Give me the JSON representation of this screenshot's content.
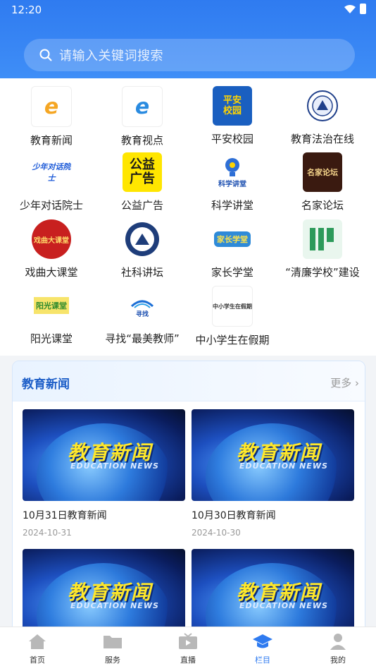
{
  "status": {
    "time": "12:20"
  },
  "search": {
    "placeholder": "请输入关键词搜索"
  },
  "categories": [
    {
      "label": "教育新闻",
      "icon": "education-news-logo",
      "text": "教育新闻"
    },
    {
      "label": "教育视点",
      "icon": "education-viewpoint-logo",
      "text": "教育视点"
    },
    {
      "label": "平安校园",
      "icon": "safe-campus-logo",
      "text": "平安校园"
    },
    {
      "label": "教育法治在线",
      "icon": "education-law-emblem",
      "text": ""
    },
    {
      "label": "少年对话院士",
      "icon": "youth-dialogue-logo",
      "text": "少年对话院士"
    },
    {
      "label": "公益广告",
      "icon": "public-ad-logo",
      "text": "公益广告"
    },
    {
      "label": "科学讲堂",
      "icon": "science-lecture-bulb",
      "text": "科学讲堂"
    },
    {
      "label": "名家论坛",
      "icon": "master-forum-logo",
      "text": "名家论坛"
    },
    {
      "label": "戏曲大课堂",
      "icon": "opera-class-logo",
      "text": "戏曲大课堂"
    },
    {
      "label": "社科讲坛",
      "icon": "social-science-emblem",
      "text": ""
    },
    {
      "label": "家长学堂",
      "icon": "parent-school-logo",
      "text": "家长学堂"
    },
    {
      "label": "“清廉学校”建设",
      "icon": "clean-school-logo",
      "text": ""
    },
    {
      "label": "阳光课堂",
      "icon": "sunshine-class-logo",
      "text": "阳光课堂"
    },
    {
      "label": "寻找“最美教师”",
      "icon": "best-teacher-logo",
      "text": "寻找 “最美教师”"
    },
    {
      "label": "中小学生在假期",
      "icon": "students-holiday-logo",
      "text": "中小学生在假期"
    }
  ],
  "news": {
    "title": "教育新闻",
    "more": "更多",
    "thumb_title": "教育新闻",
    "thumb_sub": "EDUCATION NEWS",
    "items": [
      {
        "title": "10月31日教育新闻",
        "date": "2024-10-31"
      },
      {
        "title": "10月30日教育新闻",
        "date": "2024-10-30"
      },
      {
        "title": "",
        "date": ""
      },
      {
        "title": "",
        "date": ""
      }
    ]
  },
  "tabs": [
    {
      "label": "首页",
      "icon": "home-icon"
    },
    {
      "label": "服务",
      "icon": "folder-icon"
    },
    {
      "label": "直播",
      "icon": "tv-icon"
    },
    {
      "label": "栏目",
      "icon": "graduation-cap-icon",
      "active": true
    },
    {
      "label": "我的",
      "icon": "user-icon"
    }
  ],
  "colors": {
    "accent": "#2f7bf0",
    "header": "#3f8ef7",
    "news_title": "#1e5fc8"
  }
}
